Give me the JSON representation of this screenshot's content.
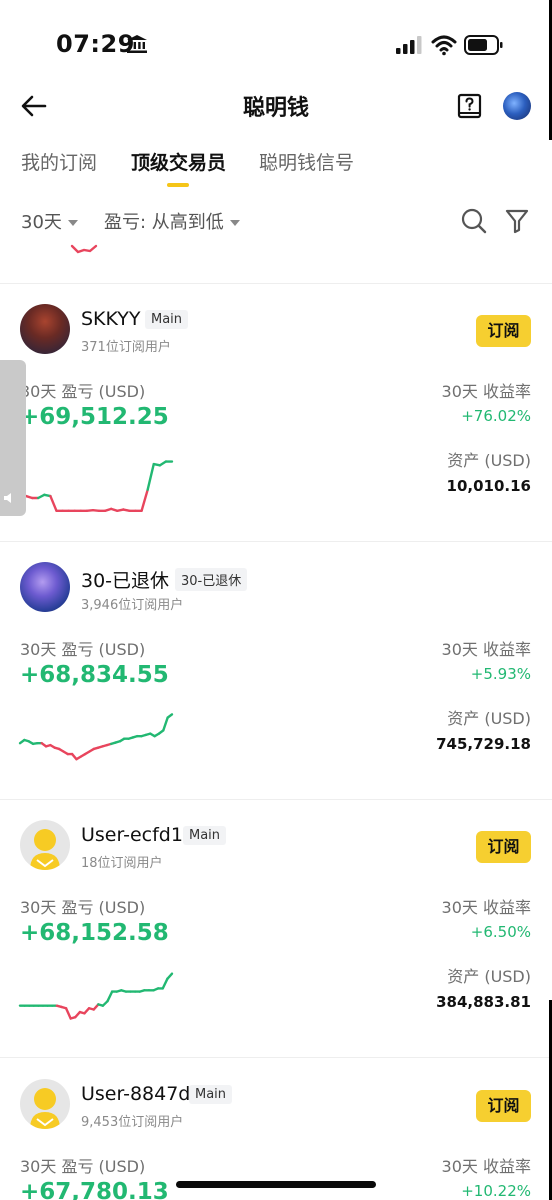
{
  "status_bar": {
    "time": "07:29"
  },
  "header": {
    "title": "聪明钱"
  },
  "tabs": [
    {
      "label": "我的订阅"
    },
    {
      "label": "顶级交易员"
    },
    {
      "label": "聪明钱信号"
    }
  ],
  "filters": {
    "period": "30天",
    "sort": "盈亏: 从高到低"
  },
  "labels": {
    "pnl": "30天 盈亏 (USD)",
    "roi": "30天 收益率",
    "assets": "资产 (USD)",
    "subscribe": "订阅"
  },
  "traders": [
    {
      "name": "SKKYY",
      "tag": "Main",
      "subscribers": "371位订阅用户",
      "pnl": "+69,512.25",
      "roi": "+76.02%",
      "assets": "10,010.16",
      "sparkline": [
        0.72,
        0.72,
        0.75,
        0.75,
        0.7,
        0.72,
        0.95,
        0.95,
        0.95,
        0.95,
        0.95,
        0.95,
        0.94,
        0.95,
        0.95,
        0.92,
        0.95,
        0.93,
        0.95,
        0.95,
        0.95,
        0.62,
        0.22,
        0.24,
        0.18,
        0.18
      ],
      "avatar_colors": [
        "#7a2f28",
        "#1d2340"
      ]
    },
    {
      "name": "30-已退休",
      "tag": "30-已退休",
      "subscribers": "3,946位订阅用户",
      "pnl": "+68,834.55",
      "roi": "+5.93%",
      "assets": "745,729.18",
      "sparkline": [
        0.55,
        0.5,
        0.52,
        0.56,
        0.55,
        0.55,
        0.6,
        0.58,
        0.62,
        0.64,
        0.68,
        0.72,
        0.72,
        0.8,
        0.76,
        0.72,
        0.68,
        0.64,
        0.62,
        0.6,
        0.58,
        0.56,
        0.54,
        0.52,
        0.48,
        0.48,
        0.46,
        0.44,
        0.44,
        0.42,
        0.4,
        0.44,
        0.4,
        0.35,
        0.15,
        0.1
      ],
      "avatar_colors": [
        "#8c6fd8",
        "#1c3a86"
      ]
    },
    {
      "name": "User-ecfd1",
      "tag": "Main",
      "subscribers": "18位订阅用户",
      "pnl": "+68,152.58",
      "roi": "+6.50%",
      "assets": "384,883.81",
      "sparkline": [
        0.62,
        0.62,
        0.62,
        0.62,
        0.62,
        0.62,
        0.62,
        0.62,
        0.62,
        0.64,
        0.66,
        0.82,
        0.8,
        0.72,
        0.74,
        0.66,
        0.68,
        0.6,
        0.62,
        0.55,
        0.4,
        0.4,
        0.38,
        0.4,
        0.4,
        0.4,
        0.4,
        0.38,
        0.38,
        0.38,
        0.35,
        0.35,
        0.2,
        0.12
      ],
      "avatar_colors": [
        "#f7cb24",
        "#dddddd"
      ]
    },
    {
      "name": "User-8847d",
      "tag": "Main",
      "subscribers": "9,453位订阅用户",
      "pnl": "+67,780.13",
      "roi": "+10.22%",
      "assets": "",
      "sparkline": [],
      "avatar_colors": [
        "#f7cb24",
        "#dddddd"
      ]
    }
  ],
  "colors": {
    "accent": "#f6cf30",
    "profit": "#22b872",
    "loss": "#e8455d"
  }
}
